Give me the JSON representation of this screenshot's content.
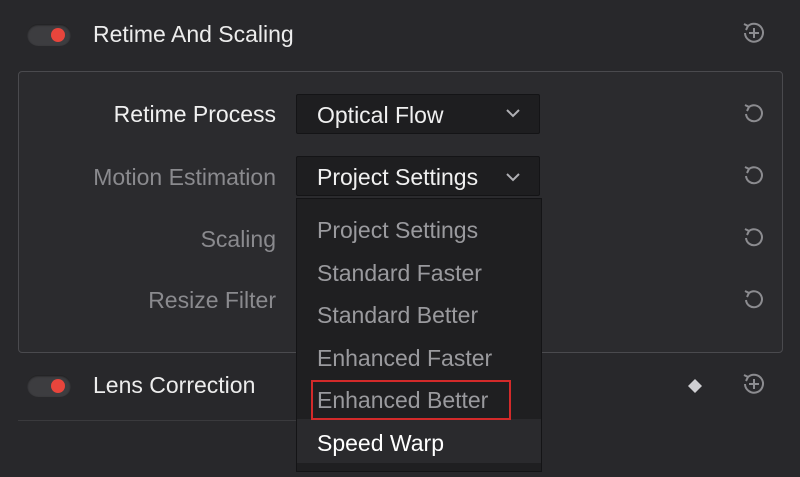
{
  "sections": {
    "retime": {
      "title": "Retime And Scaling",
      "enabled": true
    },
    "lens": {
      "title": "Lens Correction",
      "enabled": true
    }
  },
  "fields": {
    "retime_process": {
      "label": "Retime Process",
      "value": "Optical Flow"
    },
    "motion_estimation": {
      "label": "Motion Estimation",
      "value": "Project Settings"
    },
    "scaling": {
      "label": "Scaling"
    },
    "resize_filter": {
      "label": "Resize Filter"
    }
  },
  "dropdown_menu": {
    "options": [
      "Project Settings",
      "Standard Faster",
      "Standard Better",
      "Enhanced Faster",
      "Enhanced Better",
      "Speed Warp"
    ],
    "highlighted": "Enhanced Better",
    "hovered": "Speed Warp"
  },
  "icons": {
    "toggle": "toggle-icon",
    "reset": "reset-icon",
    "add_keyframe": "add-keyframe-icon",
    "keyframe": "keyframe-diamond-icon",
    "chevron": "chevron-down-icon"
  },
  "colors": {
    "background": "#28282b",
    "toggle_on": "#e8453c",
    "highlight_box": "#d32a2a"
  }
}
